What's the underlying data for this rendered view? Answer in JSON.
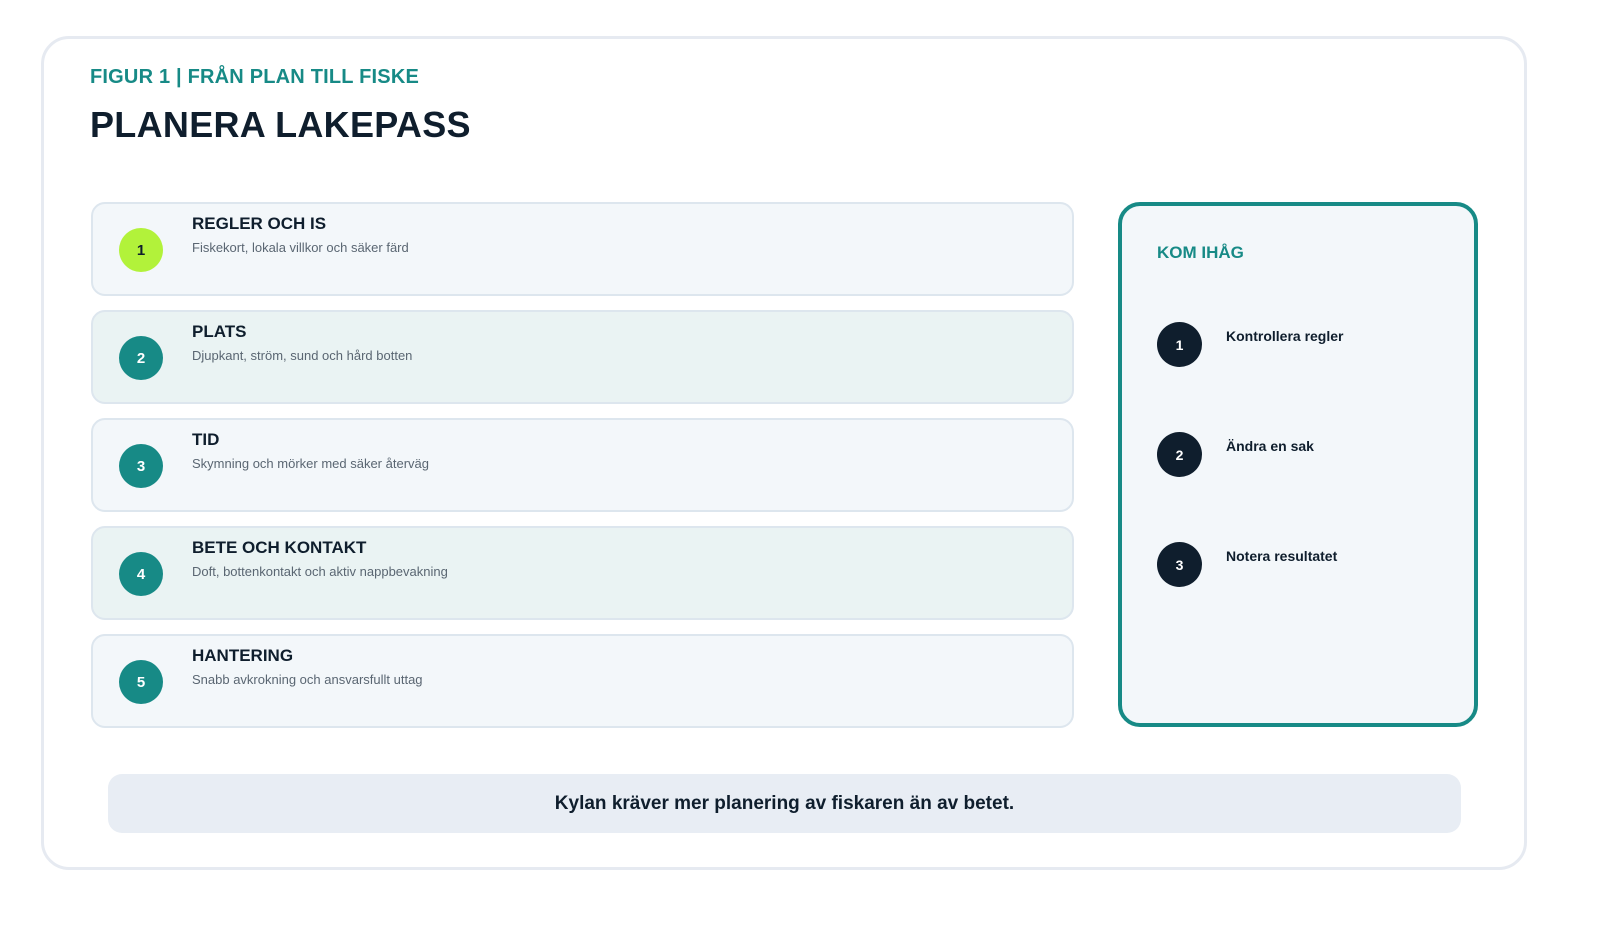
{
  "header": {
    "eyebrow": "FIGUR 1 | FRÅN PLAN TILL FISKE",
    "title": "PLANERA LAKEPASS"
  },
  "steps": [
    {
      "number": "1",
      "label": "REGLER OCH IS",
      "description": "Fiskekort, lokala villkor och säker färd",
      "highlighted": true
    },
    {
      "number": "2",
      "label": "PLATS",
      "description": "Djupkant, ström, sund och hård botten",
      "highlighted": false
    },
    {
      "number": "3",
      "label": "TID",
      "description": "Skymning och mörker med säker återväg",
      "highlighted": false
    },
    {
      "number": "4",
      "label": "BETE OCH KONTAKT",
      "description": "Doft, bottenkontakt och aktiv nappbevakning",
      "highlighted": false
    },
    {
      "number": "5",
      "label": "HANTERING",
      "description": "Snabb avkrokning och ansvarsfullt uttag",
      "highlighted": false
    }
  ],
  "remember": {
    "heading": "KOM IHÅG",
    "items": [
      {
        "number": "1",
        "text": "Kontrollera regler"
      },
      {
        "number": "2",
        "text": "Ändra en sak"
      },
      {
        "number": "3",
        "text": "Notera resultatet"
      }
    ]
  },
  "footer": {
    "text": "Kylan kräver mer planering av fiskaren än av betet."
  },
  "colors": {
    "accent": "#178a86",
    "highlight": "#b2f23a",
    "dark": "#0f1e2d",
    "footer_bg": "#e8edf4"
  }
}
